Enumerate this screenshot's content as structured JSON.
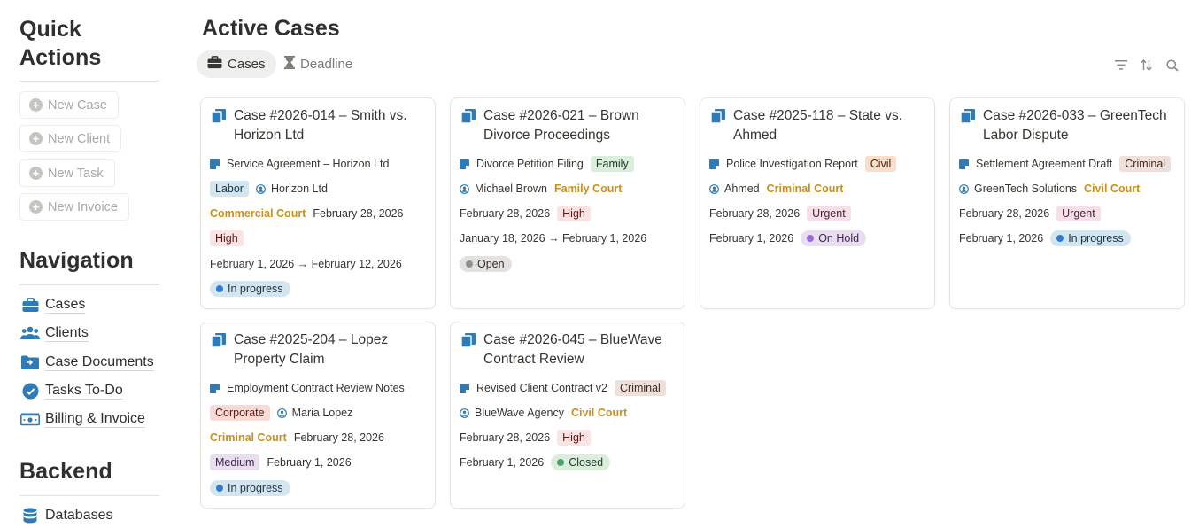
{
  "sidebar": {
    "quick_actions_title": "Quick Actions",
    "quick_actions": [
      "New Case",
      "New Client",
      "New Task",
      "New Invoice"
    ],
    "navigation_title": "Navigation",
    "navigation": [
      {
        "label": "Cases",
        "icon": "briefcase-icon"
      },
      {
        "label": "Clients",
        "icon": "users-icon"
      },
      {
        "label": "Case Documents",
        "icon": "folder-icon"
      },
      {
        "label": "Tasks To-Do",
        "icon": "check-circle-icon"
      },
      {
        "label": "Billing & Invoice",
        "icon": "money-icon"
      }
    ],
    "backend_title": "Backend",
    "backend": [
      {
        "label": "Databases",
        "icon": "database-icon"
      }
    ]
  },
  "main": {
    "title": "Active Cases",
    "tabs": [
      {
        "label": "Cases",
        "active": true,
        "icon": "briefcase-icon"
      },
      {
        "label": "Deadline",
        "active": false,
        "icon": "hourglass-icon"
      }
    ],
    "tools": [
      "filter-icon",
      "sort-icon",
      "search-icon"
    ]
  },
  "colors": {
    "accent_blue": "#2e7bb8",
    "court_gold": "#c9901f"
  },
  "cards": [
    {
      "title": "Case #2026-014 – Smith vs. Horizon Ltd",
      "document": "Service Agreement – Horizon Ltd",
      "type": "Labor",
      "client": "Horizon Ltd",
      "court": "Commercial Court",
      "deadline": "February 28, 2026",
      "priority": "High",
      "period": "February 1, 2026 → February 12, 2026",
      "status": "In progress"
    },
    {
      "title": "Case #2026-021 – Brown Divorce Proceedings",
      "document": "Divorce Petition Filing",
      "type": "Family",
      "client": "Michael Brown",
      "court": "Family Court",
      "deadline": "February 28, 2026",
      "priority": "High",
      "period": "January 18, 2026 → February 1, 2026",
      "status": "Open"
    },
    {
      "title": "Case #2025-118 – State vs. Ahmed",
      "document": "Police Investigation Report",
      "type": "Civil",
      "client": "Ahmed",
      "court": "Criminal Court",
      "deadline": "February 28, 2026",
      "priority": "Urgent",
      "period": "February 1, 2026",
      "status": "On Hold"
    },
    {
      "title": "Case #2026-033 – GreenTech Labor Dispute",
      "document": "Settlement Agreement Draft",
      "type": "Criminal",
      "client": "GreenTech Solutions",
      "court": "Civil Court",
      "deadline": "February 28, 2026",
      "priority": "Urgent",
      "period": "February 1, 2026",
      "status": "In progress"
    },
    {
      "title": "Case #2025-204 – Lopez Property Claim",
      "document": "Employment Contract Review Notes",
      "type": "Corporate",
      "client": "Maria Lopez",
      "court": "Criminal Court",
      "deadline": "February 28, 2026",
      "priority": "Medium",
      "period": "February 1, 2026",
      "status": "In progress"
    },
    {
      "title": "Case #2026-045 – BlueWave Contract Review",
      "document": "Revised Client Contract v2",
      "type": "Criminal",
      "client": "BlueWave Agency",
      "court": "Civil Court",
      "deadline": "February 28, 2026",
      "priority": "High",
      "period": "February 1, 2026",
      "status": "Closed"
    }
  ]
}
